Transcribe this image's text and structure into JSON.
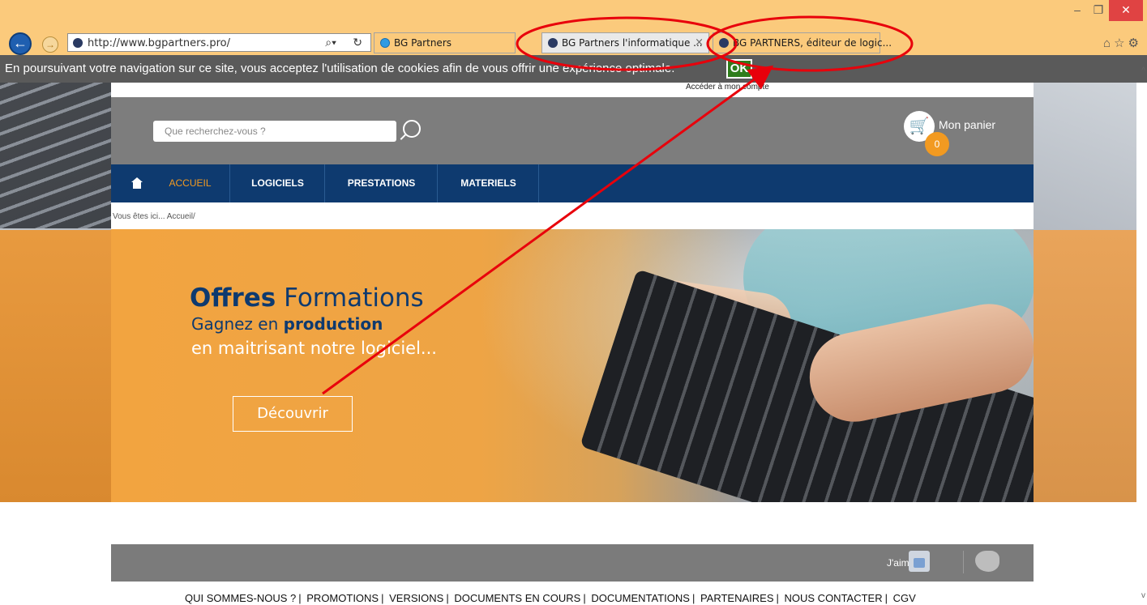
{
  "browser": {
    "url": "http://www.bgpartners.pro/",
    "tabs": [
      {
        "label": "BG Partners",
        "type": "ie"
      },
      {
        "label": "BG Partners l'informatique ...",
        "active": true
      },
      {
        "label": "BG PARTNERS, éditeur de logic..."
      }
    ],
    "close_tab_glyph": "×"
  },
  "cookie": {
    "text": "En poursuivant votre navigation sur ce site, vous acceptez l'utilisation de cookies afin de vous offrir une expérience optimale.",
    "ok": "OK"
  },
  "account": {
    "label": "Accéder à mon compte"
  },
  "search": {
    "placeholder": "Que recherchez-vous ?"
  },
  "cart": {
    "label": "Mon panier",
    "count": "0"
  },
  "nav": {
    "items": [
      "ACCUEIL",
      "LOGICIELS",
      "PRESTATIONS",
      "MATERIELS"
    ]
  },
  "breadcrumb": "Vous êtes ici... Accueil/",
  "hero": {
    "title_bold": "Offres",
    "title_rest": " Formations",
    "line2_a": "Gagnez en ",
    "line2_b": "production",
    "line3": "en maitrisant notre logiciel...",
    "cta": "Découvrir"
  },
  "social": {
    "like": "J'aime"
  },
  "footer": {
    "links": [
      "QUI SOMMES-NOUS ?",
      "PROMOTIONS",
      "VERSIONS",
      "DOCUMENTS EN COURS",
      "DOCUMENTATIONS",
      "PARTENAIRES",
      "NOUS CONTACTER",
      "CGV"
    ]
  },
  "colors": {
    "nav": "#0e3a6f",
    "accent": "#f29a21",
    "annotation": "#e8000b"
  }
}
